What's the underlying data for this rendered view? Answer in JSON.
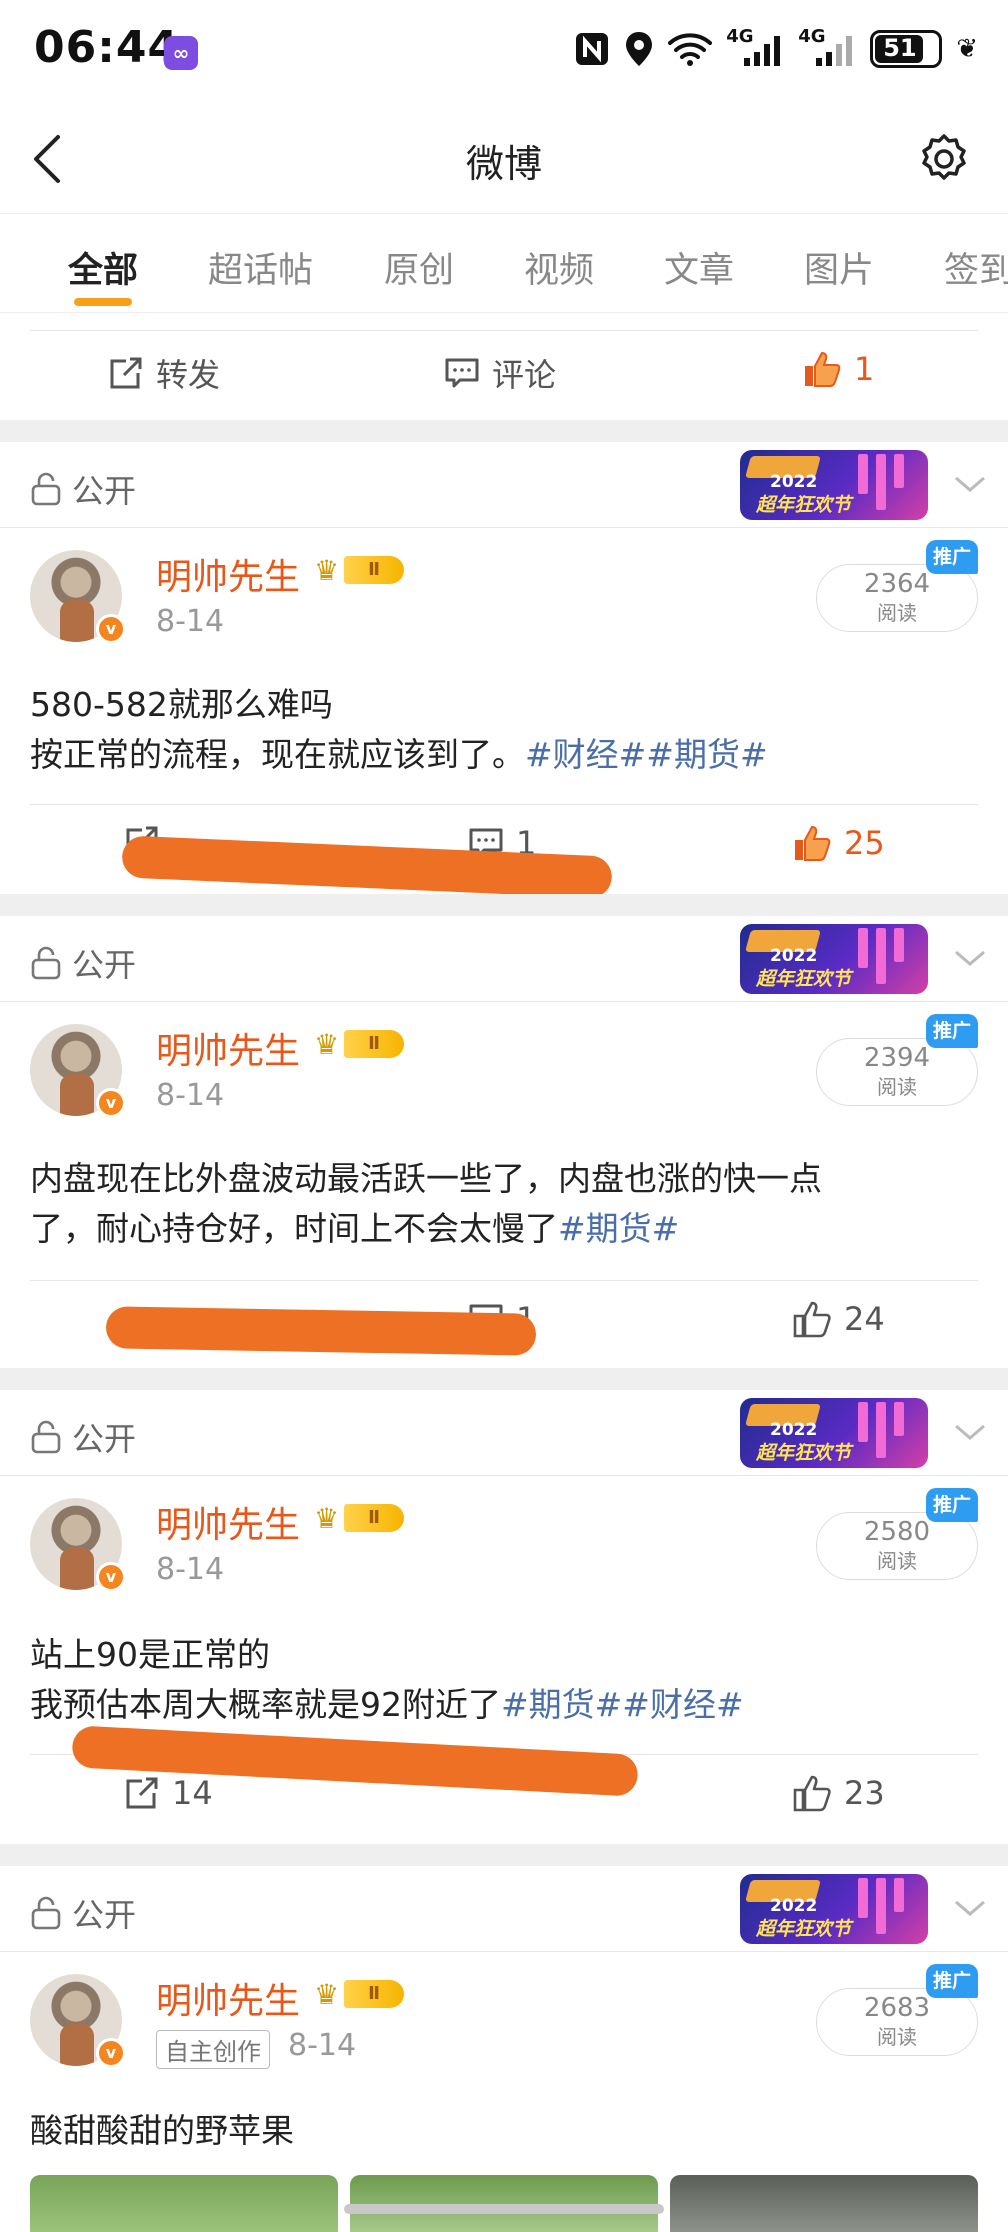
{
  "status_bar": {
    "time": "06:44",
    "battery": "51",
    "net1": "4G",
    "net2": "4G"
  },
  "nav": {
    "title": "微博"
  },
  "tabs": [
    "全部",
    "超话帖",
    "原创",
    "视频",
    "文章",
    "图片",
    "签到"
  ],
  "prev_actions": {
    "repost": "转发",
    "comment": "评论",
    "like": "1"
  },
  "public_label": "公开",
  "banner": {
    "year": "2022",
    "text": "超年狂欢节"
  },
  "badges": {
    "level": "Ⅱ",
    "promote": "推广",
    "reads_label": "阅读",
    "original": "自主创作"
  },
  "posts": [
    {
      "author": "明帅先生",
      "date": "8-14",
      "reads": "2364",
      "line1": "580-582就那么难吗",
      "line2_text": "按正常的流程，现在就应该到了。",
      "line2_tags": "#财经##期货#",
      "comments": "1",
      "likes": "25"
    },
    {
      "author": "明帅先生",
      "date": "8-14",
      "reads": "2394",
      "line1": "内盘现在比外盘波动最活跃一些了，内盘也涨的快一点",
      "line2_text": "了，耐心持仓好，时间上不会太慢了",
      "line2_tags": "#期货#",
      "comments": "1",
      "likes": "24"
    },
    {
      "author": "明帅先生",
      "date": "8-14",
      "reads": "2580",
      "line1": "站上90是正常的",
      "line2_text": "我预估本周大概率就是92附近了",
      "line2_tags": "#期货##财经#",
      "reposts": "14",
      "likes": "23"
    },
    {
      "author": "明帅先生",
      "date": "8-14",
      "reads": "2683",
      "line1": "酸甜酸甜的野苹果"
    }
  ],
  "colors": {
    "accent": "#e8581a",
    "tag": "#4a6fa8",
    "indicator": "#f8a01a",
    "promote": "#2e9cf0"
  }
}
